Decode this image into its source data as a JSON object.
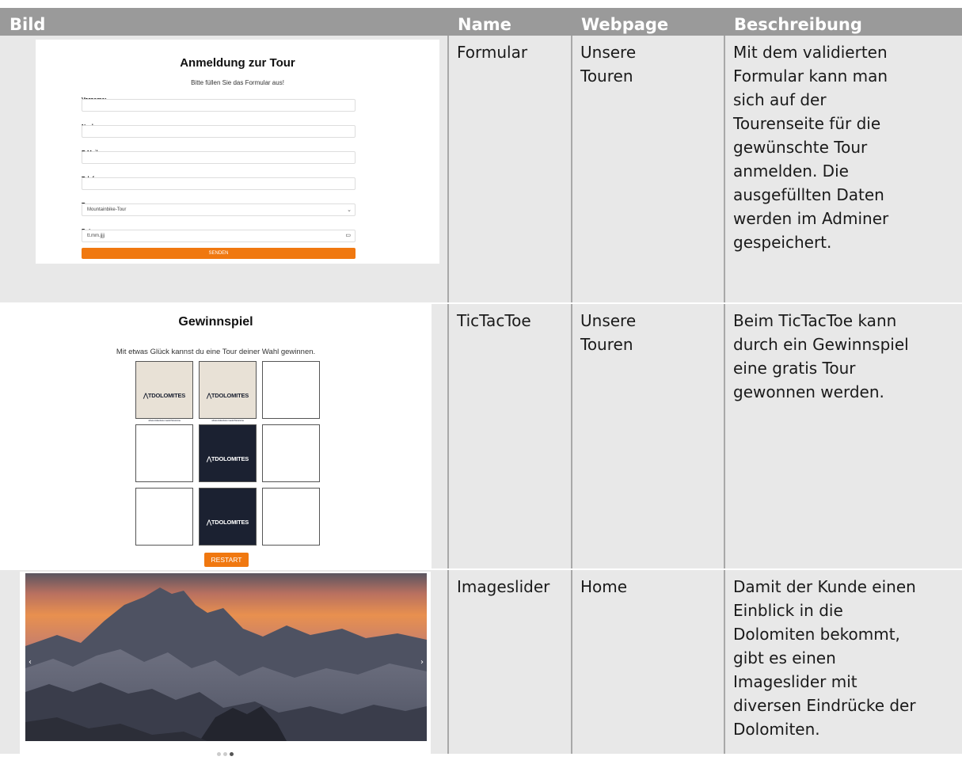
{
  "table": {
    "headers": [
      "Bild",
      "Name",
      "Webpage",
      "Beschreibung"
    ],
    "rows": [
      {
        "name": "Formular",
        "webpage": "Unsere\nTouren",
        "description": "Mit dem validierten\nFormular kann man\nsich auf der\nTourenseite für die\ngewünschte Tour\nanmelden. Die\nausgefüllten Daten\nwerden im Adminer\ngespeichert."
      },
      {
        "name": "TicTacToe",
        "webpage": "Unsere\nTouren",
        "description": "Beim TicTacToe kann\ndurch ein Gewinnspiel\neine gratis Tour\ngewonnen werden."
      },
      {
        "name": "Imageslider",
        "webpage": "Home",
        "description": "Damit der Kunde einen\nEinblick in die\nDolomiten bekommt,\ngibt es einen\nImageslider mit\ndiversen Eindrücke der\nDolomiten."
      }
    ]
  },
  "form_shot": {
    "title": "Anmeldung zur Tour",
    "subtitle": "Bitte füllen Sie das Formular aus!",
    "labels": {
      "vorname": "Vorname:",
      "nachname": "Nachname:",
      "email": "E-Mail:",
      "telefon": "Telefonnummer:",
      "tour": "Tour:",
      "datum": "Datum:"
    },
    "tour_value": "Mountainbike-Tour",
    "date_placeholder": "tt.mm.jjjj",
    "submit_label": "SENDEN",
    "accent": "#f07810"
  },
  "ttt_shot": {
    "title": "Gewinnspiel",
    "subtitle": "Mit etwas Glück kannst du eine Tour deiner Wahl gewinnen.",
    "board": [
      "X",
      "X",
      "",
      "",
      "O",
      "",
      "",
      "O",
      ""
    ],
    "logo_text": "TDOLOMITES",
    "logo_tagline": "where Adventure meets Panorama",
    "restart_label": "RESTART",
    "colors": {
      "x_bg": "#e8e1d6",
      "o_bg": "#1b2131",
      "accent": "#f07810"
    }
  },
  "slider_shot": {
    "prev_icon": "chevron-left-icon",
    "next_icon": "chevron-right-icon",
    "prev_glyph": "‹",
    "next_glyph": "›",
    "dots": 3,
    "active_dot": 3
  }
}
